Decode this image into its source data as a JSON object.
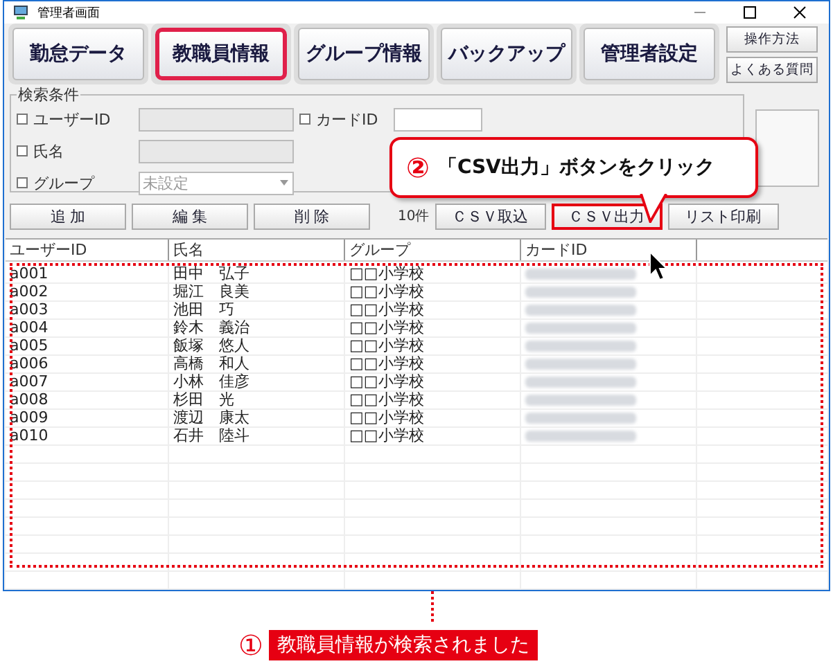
{
  "window": {
    "title": "管理者画面"
  },
  "nav_buttons": [
    {
      "label": "勤怠データ",
      "highlighted": false
    },
    {
      "label": "教職員情報",
      "highlighted": true
    },
    {
      "label": "グループ情報",
      "highlighted": false
    },
    {
      "label": "バックアップ",
      "highlighted": false
    },
    {
      "label": "管理者設定",
      "highlighted": false
    }
  ],
  "help_buttons": [
    "操作方法",
    "よくある質問"
  ],
  "search": {
    "title": "検索条件",
    "fields": [
      {
        "label": "ユーザーID",
        "checked": false,
        "kind": "text"
      },
      {
        "label": "氏名",
        "checked": false,
        "kind": "text"
      },
      {
        "label": "グループ",
        "checked": false,
        "kind": "select",
        "value": "未設定"
      }
    ],
    "card_field": {
      "label": "カードID",
      "checked": false
    }
  },
  "actions": [
    {
      "label": "追 加",
      "highlighted": false
    },
    {
      "label": "編 集",
      "highlighted": false
    },
    {
      "label": "削 除",
      "highlighted": false
    }
  ],
  "count": "10件",
  "tools": [
    {
      "label": "ＣＳＶ取込",
      "highlighted": false
    },
    {
      "label": "ＣＳＶ出力",
      "highlighted": true
    },
    {
      "label": "リスト印刷",
      "highlighted": false
    }
  ],
  "table": {
    "columns": [
      "ユーザーID",
      "氏名",
      "グループ",
      "カードID"
    ],
    "rows": [
      [
        "a001",
        "田中　弘子",
        "□□小学校"
      ],
      [
        "a002",
        "堀江　良美",
        "□□小学校"
      ],
      [
        "a003",
        "池田　巧",
        "□□小学校"
      ],
      [
        "a004",
        "鈴木　義治",
        "□□小学校"
      ],
      [
        "a005",
        "飯塚　悠人",
        "□□小学校"
      ],
      [
        "a006",
        "高橋　和人",
        "□□小学校"
      ],
      [
        "a007",
        "小林　佳彦",
        "□□小学校"
      ],
      [
        "a008",
        "杉田　光",
        "□□小学校"
      ],
      [
        "a009",
        "渡辺　康太",
        "□□小学校"
      ],
      [
        "a010",
        "石井　陸斗",
        "□□小学校"
      ]
    ]
  },
  "callout_step": {
    "number": "②",
    "text": "「CSV出力」ボタンをクリック"
  },
  "caption_step": {
    "number": "①",
    "text": "教職員情報が検索されました"
  }
}
